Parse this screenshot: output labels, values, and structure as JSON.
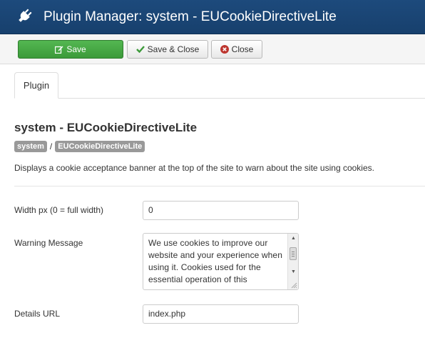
{
  "header": {
    "title": "Plugin Manager: system - EUCookieDirectiveLite",
    "icon": "plug-icon"
  },
  "toolbar": {
    "save_label": "Save",
    "save_close_label": "Save & Close",
    "close_label": "Close",
    "save_color": "#46a546"
  },
  "tabs": [
    {
      "label": "Plugin",
      "active": true
    }
  ],
  "plugin": {
    "title": "system - EUCookieDirectiveLite",
    "badges": [
      "system",
      "EUCookieDirectiveLite"
    ],
    "separator": "/",
    "description": "Displays a cookie acceptance banner at the top of the site to warn about the site using cookies."
  },
  "fields": {
    "width": {
      "label": "Width px (0 = full width)",
      "value": "0"
    },
    "warning": {
      "label": "Warning Message",
      "value": "We use cookies to improve our website and your experience when using it. Cookies used for the essential operation of this"
    },
    "details_url": {
      "label": "Details URL",
      "value": "index.php"
    }
  }
}
